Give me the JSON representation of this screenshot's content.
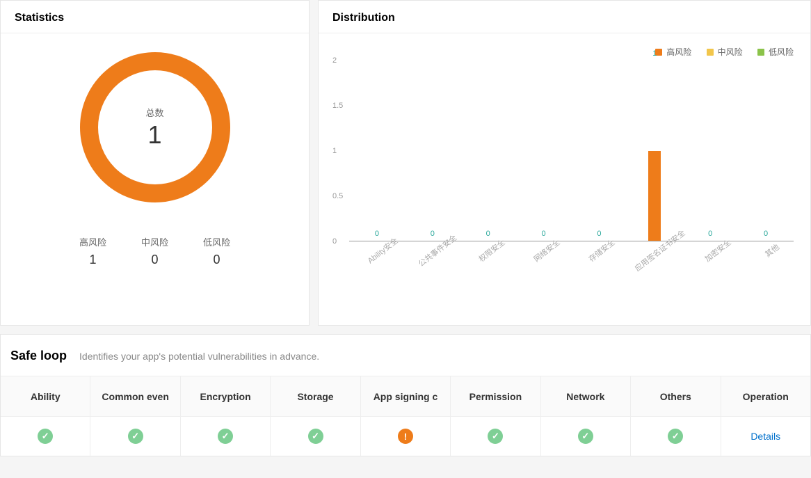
{
  "colors": {
    "high": "#ee7c1a",
    "mid": "#f2c64b",
    "low": "#8bc34a",
    "ok_icon": "#7fcf95",
    "warn_icon": "#ee7c1a",
    "link": "#0070cc",
    "value_label": "#2aa89b"
  },
  "statistics": {
    "title": "Statistics",
    "total_label": "总数",
    "total_value": "1",
    "risks": [
      {
        "label": "高风险",
        "value": "1"
      },
      {
        "label": "中风险",
        "value": "0"
      },
      {
        "label": "低风险",
        "value": "0"
      }
    ]
  },
  "distribution": {
    "title": "Distribution",
    "legend": [
      {
        "label": "高风险",
        "color": "#ee7c1a"
      },
      {
        "label": "中风险",
        "color": "#f2c64b"
      },
      {
        "label": "低风险",
        "color": "#8bc34a"
      }
    ],
    "y_ticks": [
      "0",
      "0.5",
      "1",
      "1.5",
      "2"
    ]
  },
  "chart_data": {
    "type": "bar",
    "title": "Distribution",
    "xlabel": "",
    "ylabel": "",
    "ylim": [
      0,
      2
    ],
    "categories": [
      "Ability安全",
      "公共事件安全",
      "权限安全",
      "网络安全",
      "存储安全",
      "应用签名证书安全",
      "加密安全",
      "其他"
    ],
    "series": [
      {
        "name": "高风险",
        "color": "#ee7c1a",
        "values": [
          0,
          0,
          0,
          0,
          0,
          1,
          0,
          0
        ]
      }
    ],
    "value_labels": [
      "0",
      "0",
      "0",
      "0",
      "0",
      "1",
      "0",
      "0"
    ]
  },
  "safe_loop": {
    "title": "Safe loop",
    "subtitle": "Identifies your app's potential vulnerabilities in advance.",
    "columns": [
      {
        "label": "Ability",
        "status": "ok"
      },
      {
        "label": "Common even",
        "status": "ok"
      },
      {
        "label": "Encryption",
        "status": "ok"
      },
      {
        "label": "Storage",
        "status": "ok"
      },
      {
        "label": "App signing c",
        "status": "warn"
      },
      {
        "label": "Permission",
        "status": "ok"
      },
      {
        "label": "Network",
        "status": "ok"
      },
      {
        "label": "Others",
        "status": "ok"
      }
    ],
    "operation_header": "Operation",
    "details_label": "Details"
  }
}
